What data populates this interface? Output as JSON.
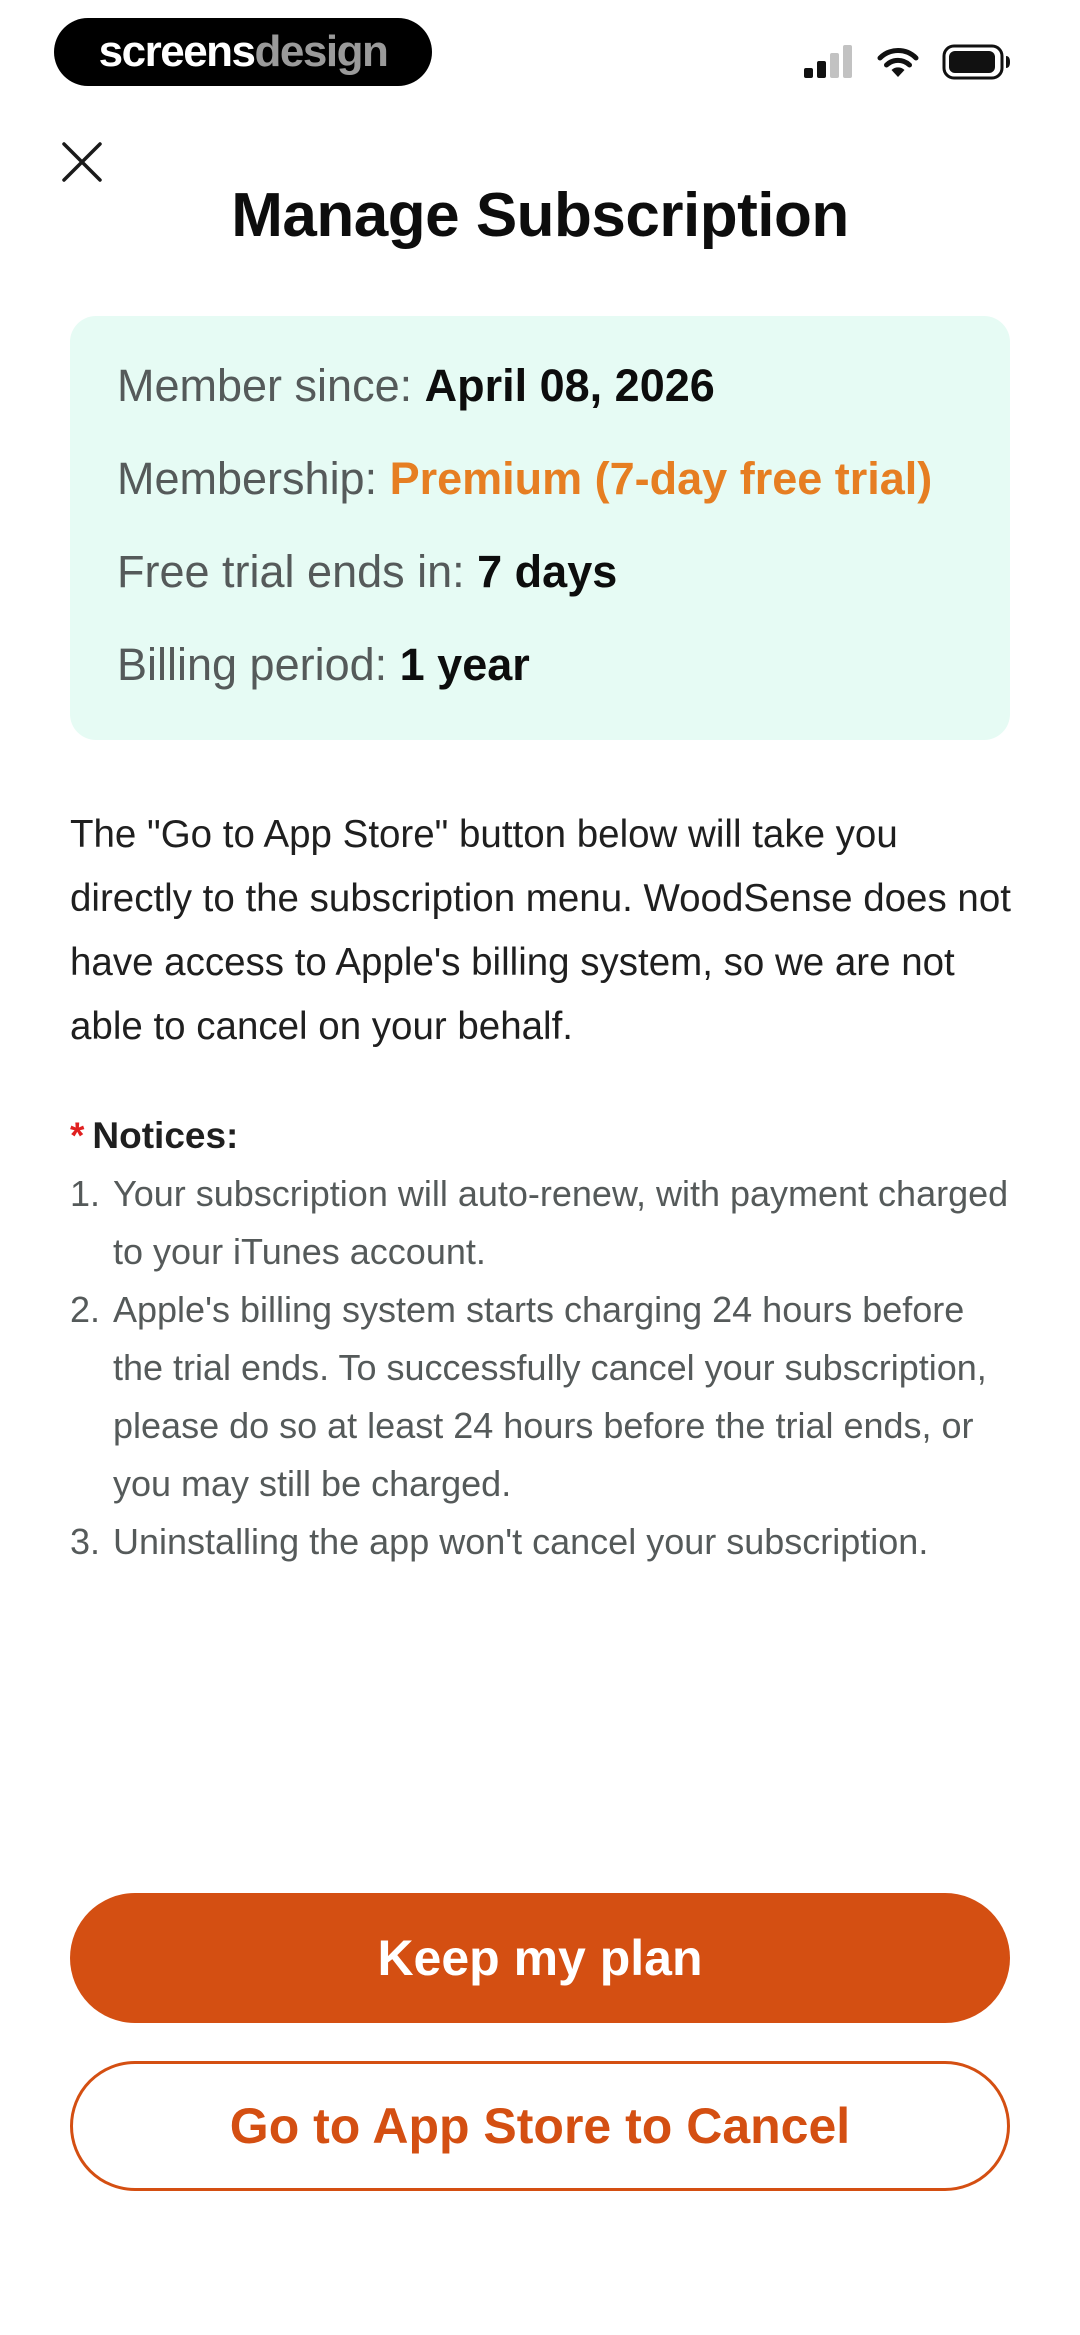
{
  "status_bar": {
    "brand_part1": "screens",
    "brand_part2": "design",
    "icons": [
      "signal-icon",
      "wifi-icon",
      "battery-icon"
    ]
  },
  "header": {
    "close_icon": "close-icon",
    "title": "Manage Subscription"
  },
  "membership": {
    "rows": [
      {
        "label": "Member since: ",
        "value": "April 08, 2026"
      },
      {
        "label": "Membership: ",
        "value": "Premium (7-day free trial)",
        "color": "#e67e22"
      },
      {
        "label": "Free trial ends in: ",
        "value": "7 days"
      },
      {
        "label": "Billing period: ",
        "value": "1 year"
      }
    ],
    "background": "#e6fbf4"
  },
  "description": "The \"Go to App Store\" button below will take you directly to the subscription menu. WoodSense does not have access to Apple's billing system, so we are not able to cancel on your behalf.",
  "notices": {
    "asterisk": "*",
    "heading": "Notices:",
    "items": [
      {
        "num": "1.",
        "text": "Your subscription will auto-renew, with payment charged to your iTunes account."
      },
      {
        "num": "2.",
        "text": "Apple's billing system starts charging 24 hours before the trial ends. To successfully cancel your subscription, please do so at least 24 hours before the trial ends, or you may still be charged."
      },
      {
        "num": "3.",
        "text": "Uninstalling the app won't cancel your subscription."
      }
    ]
  },
  "buttons": {
    "keep_label": "Keep my plan",
    "cancel_label": "Go to App Store to Cancel",
    "accent_color": "#d44f12"
  }
}
